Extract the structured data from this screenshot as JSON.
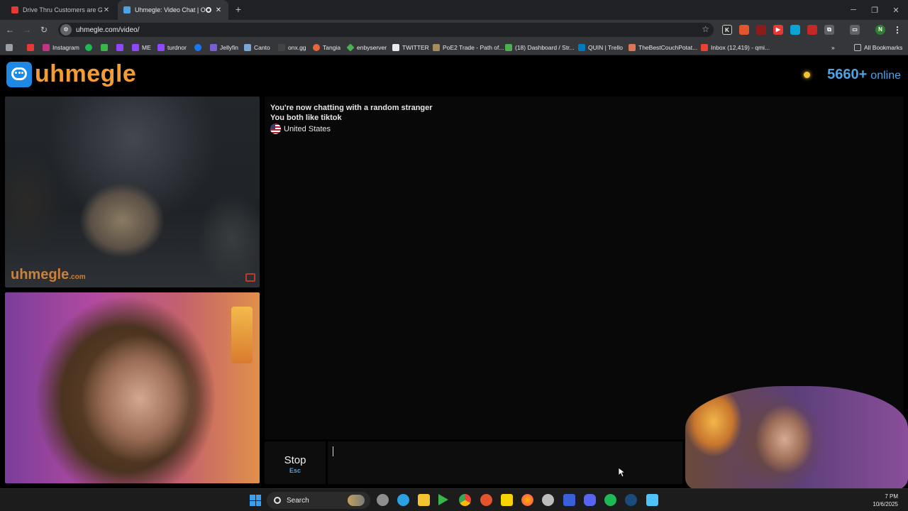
{
  "browser": {
    "tabs": [
      {
        "title": "Drive Thru Customers are Getti",
        "favicon_color": "#e53935",
        "active": false
      },
      {
        "title": "Uhmegle: Video Chat | Omeg",
        "favicon_color": "#4fa3e3",
        "active": true
      }
    ],
    "new_tab_icon": "plus-icon",
    "url": "uhmegle.com/video/",
    "bookmarks": [
      {
        "label": "",
        "color": "#e53935"
      },
      {
        "label": "Instagram",
        "color": "#c13584"
      },
      {
        "label": "",
        "color": "#1db954"
      },
      {
        "label": "",
        "color": "#3ab54a"
      },
      {
        "label": "",
        "color": "#9146ff"
      },
      {
        "label": "ME",
        "color": "#9146ff"
      },
      {
        "label": "turdnor",
        "color": "#9146ff"
      },
      {
        "label": "",
        "color": "#1877f2"
      },
      {
        "label": "Jellyfin",
        "color": "#7b5ed6"
      },
      {
        "label": "Canto",
        "color": "#7aa6d6"
      },
      {
        "label": "onx.gg",
        "color": "#444444"
      },
      {
        "label": "Tangia",
        "color": "#e8663a"
      },
      {
        "label": "enbyserver",
        "color": "#4caf50"
      },
      {
        "label": "TWITTER",
        "color": "#e8eaed"
      },
      {
        "label": "PoE2 Trade - Path of...",
        "color": "#a88b5a"
      },
      {
        "label": "(18) Dashboard / Str...",
        "color": "#4caf50"
      },
      {
        "label": "QUIN | Trello",
        "color": "#0079bf"
      },
      {
        "label": "TheBestCouchPotat...",
        "color": "#d9775a"
      },
      {
        "label": "Inbox (12,419) - qmi...",
        "color": "#ea4335"
      }
    ],
    "all_bookmarks": "All Bookmarks"
  },
  "site": {
    "logo_text": "uhmegle",
    "online_count": "5660+",
    "online_label": "online",
    "brand_color": "#f39c37",
    "accent_color": "#4fa3e3"
  },
  "stranger_video": {
    "watermark": "uhmegle",
    "watermark_suffix": ".com"
  },
  "chat": {
    "messages": [
      "You're now chatting with a random stranger",
      "You both like tiktok"
    ],
    "country": "United States"
  },
  "controls": {
    "stop_label": "Stop",
    "stop_key": "Esc",
    "input_value": ""
  },
  "taskbar": {
    "search_placeholder": "Search",
    "time": "7 PM",
    "date": "10/6/2025",
    "apps": [
      {
        "name": "settings-icon",
        "color": "#8e8e8e"
      },
      {
        "name": "edge-icon",
        "color": "#2aa1e4"
      },
      {
        "name": "file-explorer-icon",
        "color": "#f4c430"
      },
      {
        "name": "play-icon",
        "color": "#3ab54a"
      },
      {
        "name": "chrome-icon",
        "color": "#4285f4"
      },
      {
        "name": "app-icon",
        "color": "#e2552d"
      },
      {
        "name": "sticky-notes-icon",
        "color": "#f7d300"
      },
      {
        "name": "firefox-icon",
        "color": "#ff7139"
      },
      {
        "name": "app-icon",
        "color": "#bdbdbd"
      },
      {
        "name": "app-icon",
        "color": "#3b5fd9"
      },
      {
        "name": "discord-icon",
        "color": "#5865f2"
      },
      {
        "name": "spotify-icon",
        "color": "#1db954"
      },
      {
        "name": "steam-icon",
        "color": "#1b4b7a"
      },
      {
        "name": "notepad-icon",
        "color": "#4fc3f7"
      }
    ]
  }
}
